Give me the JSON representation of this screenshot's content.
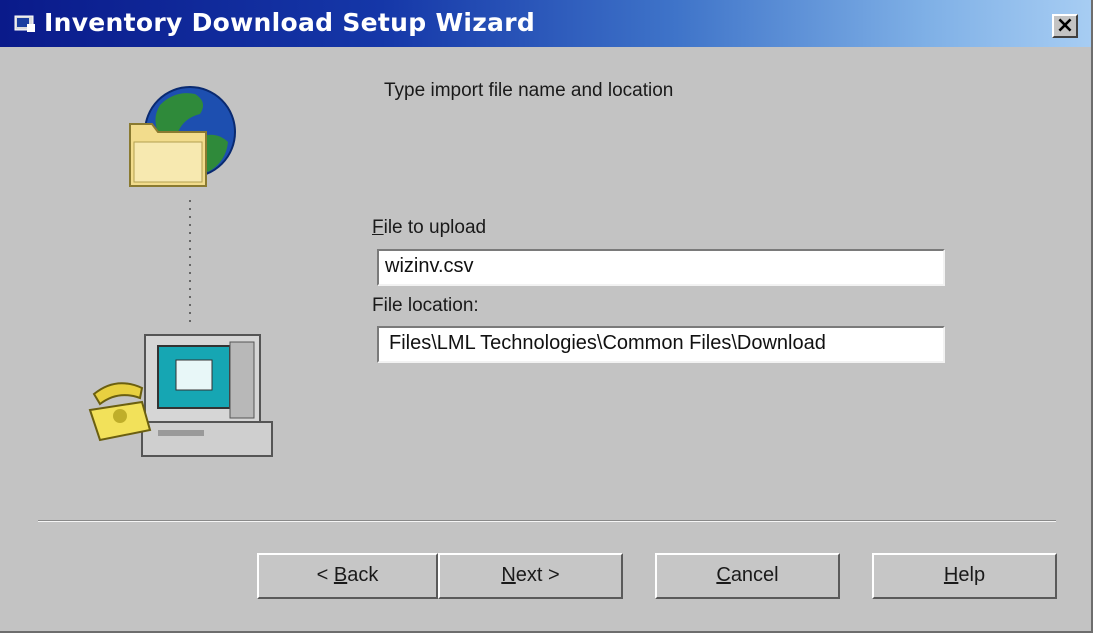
{
  "window": {
    "title": "Inventory Download Setup Wizard",
    "close_glyph": "×"
  },
  "main": {
    "instruction": "Type import file name and location",
    "file_label_mnemonic": "F",
    "file_label_rest": "ile to upload",
    "file_value": "wizinv.csv",
    "location_label": "File location:",
    "location_value": "Files\\LML Technologies\\Common Files\\Download"
  },
  "buttons": {
    "back_prefix": "< ",
    "back_mnemonic": "B",
    "back_rest": "ack",
    "next_mnemonic": "N",
    "next_rest": "ext >",
    "cancel_mnemonic": "C",
    "cancel_rest": "ancel",
    "help_mnemonic": "H",
    "help_rest": "elp"
  },
  "icons": {
    "title": "wizard-app-icon",
    "close": "close-icon",
    "globe": "globe-icon",
    "folder": "folder-icon",
    "telephone": "telephone-icon",
    "computer": "computer-icon"
  },
  "colors": {
    "title_bar_start": "#0a1a8a",
    "title_bar_end": "#a7cdf3",
    "window_face": "#c3c3c3"
  }
}
